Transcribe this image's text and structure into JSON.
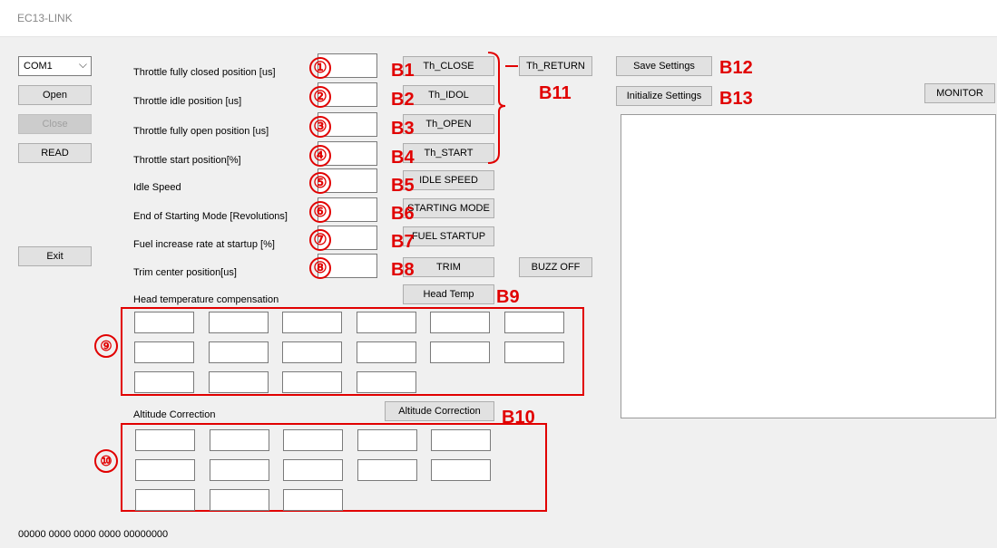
{
  "window": {
    "title": "EC13-LINK"
  },
  "left_panel": {
    "com_port": "COM1",
    "buttons": {
      "open": "Open",
      "close": "Close",
      "read": "READ",
      "exit": "Exit"
    }
  },
  "params": [
    {
      "label": "Throttle fully closed position [us]",
      "marker": "①",
      "code": "B1",
      "button": "Th_CLOSE"
    },
    {
      "label": "Throttle idle position [us]",
      "marker": "②",
      "code": "B2",
      "button": "Th_IDOL"
    },
    {
      "label": "Throttle fully open position [us]",
      "marker": "③",
      "code": "B3",
      "button": "Th_OPEN"
    },
    {
      "label": "Throttle start position[%]",
      "marker": "④",
      "code": "B4",
      "button": "Th_START"
    },
    {
      "label": "Idle Speed",
      "marker": "⑤",
      "code": "B5",
      "button": "IDLE SPEED"
    },
    {
      "label": "End of Starting Mode [Revolutions]",
      "marker": "⑥",
      "code": "B6",
      "button": "STARTING MODE"
    },
    {
      "label": "Fuel increase rate at startup [%]",
      "marker": "⑦",
      "code": "B7",
      "button": "FUEL STARTUP"
    },
    {
      "label": "Trim center position[us]",
      "marker": "⑧",
      "code": "B8",
      "button": "TRIM"
    }
  ],
  "th_return": {
    "button": "Th_RETURN",
    "code": "B11"
  },
  "buzz_off": "BUZZ OFF",
  "head_temp": {
    "label": "Head temperature compensation",
    "button": "Head Temp",
    "code": "B9",
    "marker": "⑨"
  },
  "altitude": {
    "label": "Altitude Correction",
    "button": "Altitude Correction",
    "code": "B10",
    "marker": "⑩"
  },
  "settings": {
    "save": "Save Settings",
    "save_code": "B12",
    "init": "Initialize Settings",
    "init_code": "B13"
  },
  "monitor": {
    "button": "MONITOR"
  },
  "status_line": "00000  0000 0000 0000 00000000",
  "colors": {
    "annotation": "#e10000",
    "background": "#f0f0f0"
  }
}
